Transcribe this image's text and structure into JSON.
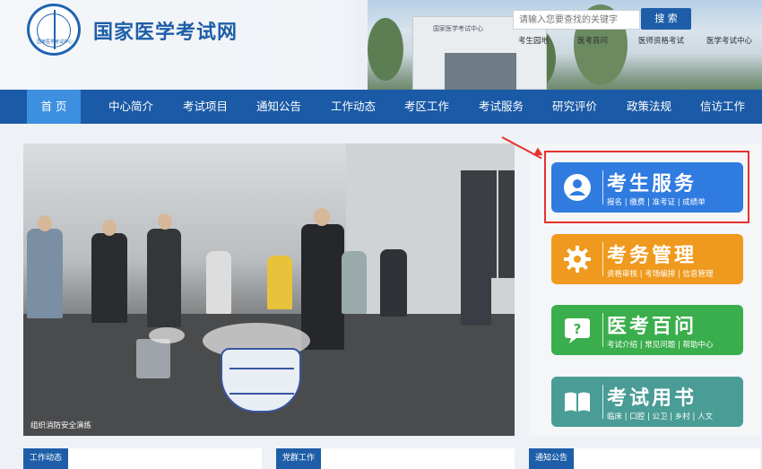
{
  "header": {
    "site_title": "国家医学考试网",
    "logo_text": "国家医学考试中心",
    "photo_sign": "国家医学考试中心",
    "search": {
      "placeholder": "请输入您要查找的关键字",
      "button_label": "搜 索"
    },
    "quick_links": [
      "考生园地",
      "医考百问",
      "医师资格考试",
      "医学考试中心"
    ]
  },
  "nav": {
    "items": [
      "首 页",
      "中心简介",
      "考试项目",
      "通知公告",
      "工作动态",
      "考区工作",
      "考试服务",
      "研究评价",
      "政策法规",
      "信访工作"
    ],
    "active_index": 0
  },
  "main": {
    "photo_caption": "组织消防安全演练"
  },
  "services": [
    {
      "title": "考生服务",
      "subtitle": "报名 | 缴费 | 准考证 | 成绩单",
      "icon": "user-icon",
      "color": "#2f7be0"
    },
    {
      "title": "考务管理",
      "subtitle": "资格审核 | 考场编排 | 信息管理",
      "icon": "gear-icon",
      "color": "#ef9a1e"
    },
    {
      "title": "医考百问",
      "subtitle": "考试介绍 | 常见问题 | 帮助中心",
      "icon": "chat-question-icon",
      "color": "#3aae4c"
    },
    {
      "title": "考试用书",
      "subtitle": "临床 | 口腔 | 公卫 | 乡村 | 人文",
      "icon": "book-icon",
      "color": "#4a9c96"
    }
  ],
  "bottom_tabs": [
    "工作动态",
    "党群工作",
    "通知公告"
  ],
  "colors": {
    "brand": "#1a5aa6",
    "nav_active": "#3d8fe0",
    "highlight": "#e5322d"
  }
}
